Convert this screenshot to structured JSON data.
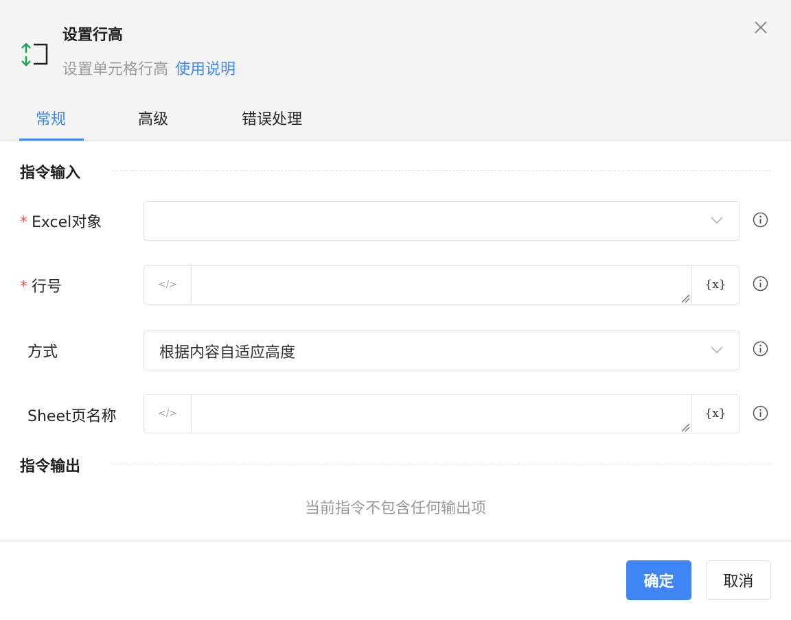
{
  "header": {
    "icon": "row-height-icon",
    "title": "设置行高",
    "subtitle": "设置单元格行高",
    "help_link": "使用说明",
    "close_icon": "close-icon"
  },
  "tabs": [
    {
      "label": "常规",
      "active": true
    },
    {
      "label": "高级",
      "active": false
    },
    {
      "label": "错误处理",
      "active": false
    }
  ],
  "input_section": {
    "title": "指令输入",
    "fields": {
      "excel_object": {
        "label": "Excel对象",
        "required": "*",
        "value": ""
      },
      "row_number": {
        "label": "行号",
        "required": "*",
        "value": "",
        "code_icon": "</>",
        "var_button": "{x}"
      },
      "mode": {
        "label": "方式",
        "value": "根据内容自适应高度"
      },
      "sheet_name": {
        "label": "Sheet页名称",
        "value": "",
        "code_icon": "</>",
        "var_button": "{x}"
      }
    }
  },
  "output_section": {
    "title": "指令输出",
    "empty_text": "当前指令不包含任何输出项"
  },
  "footer": {
    "confirm": "确定",
    "cancel": "取消"
  },
  "colors": {
    "accent": "#3f86f5",
    "required": "#f25c54",
    "icon_green": "#1aa55a",
    "header_bg": "#f4f4f5"
  }
}
